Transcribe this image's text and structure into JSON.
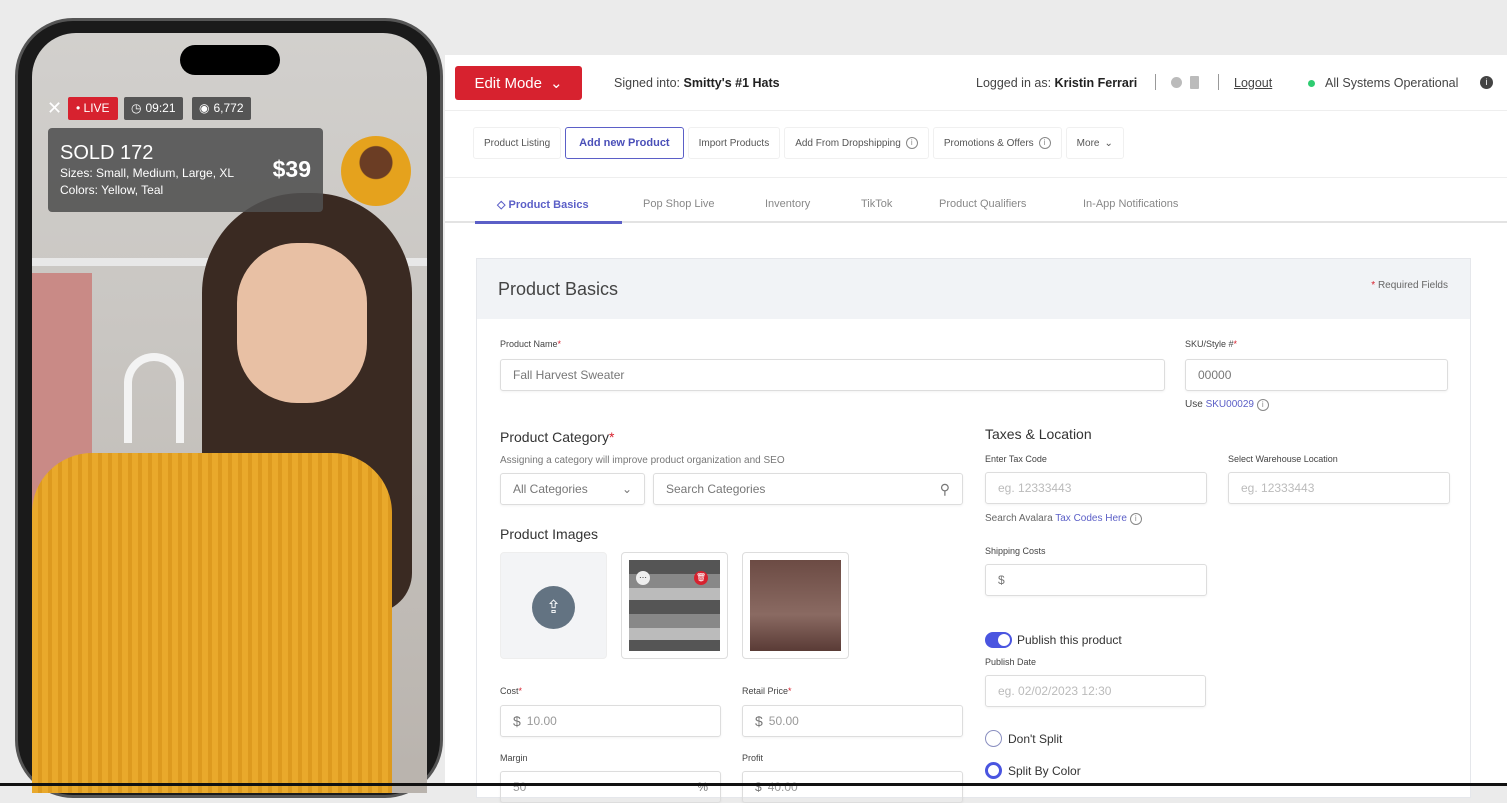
{
  "phone": {
    "live": "• LIVE",
    "time": "09:21",
    "viewers": "6,772",
    "sold": "SOLD 172",
    "sizes": "Sizes: Small, Medium, Large, XL",
    "colors": "Colors: Yellow, Teal",
    "price": "$39"
  },
  "header": {
    "edit_mode": "Edit Mode",
    "signed_into_label": "Signed into:",
    "store": "Smitty's #1 Hats",
    "logged_in_label": "Logged in as:",
    "user": "Kristin Ferrari",
    "logout": "Logout",
    "status": "All Systems Operational",
    "status_color": "#2ecc71"
  },
  "subnav": [
    "Product Listing",
    "Add new Product",
    "Import Products",
    "Add From Dropshipping",
    "Promotions & Offers",
    "More"
  ],
  "tabs": [
    "Product Basics",
    "Pop Shop Live",
    "Inventory",
    "TikTok",
    "Product Qualifiers",
    "In-App Notifications"
  ],
  "form": {
    "title": "Product Basics",
    "required_note": "Required Fields",
    "product_name_label": "Product Name",
    "product_name": "Fall Harvest Sweater",
    "sku_label": "SKU/Style #",
    "sku": "00000",
    "sku_use": "Use",
    "sku_suggest": "SKU00029",
    "category_title": "Product Category",
    "category_hint": "Assigning a category will improve product organization and SEO",
    "category_select": "All Categories",
    "category_search": "Search Categories",
    "images_title": "Product Images",
    "cost_label": "Cost",
    "cost": "10.00",
    "retail_label": "Retail Price",
    "retail": "50.00",
    "currency": "$",
    "margin_label": "Margin",
    "margin": "50",
    "margin_unit": "%",
    "profit_label": "Profit",
    "profit": "40.00",
    "taxes_title": "Taxes & Location",
    "tax_code_label": "Enter Tax Code",
    "tax_code_ph": "eg. 12333443",
    "warehouse_label": "Select Warehouse Location",
    "warehouse_ph": "eg. 12333443",
    "avalara_text": "Search Avalara",
    "avalara_link": "Tax Codes Here",
    "shipping_label": "Shipping Costs",
    "shipping": "$",
    "publish_label": "Publish this product",
    "publish_on": true,
    "publish_date_label": "Publish Date",
    "publish_date_ph": "eg. 02/02/2023 12:30",
    "split_options": [
      "Don't Split",
      "Split By Color"
    ]
  },
  "accent": "#5b5fc7",
  "brand_red": "#d7222f"
}
